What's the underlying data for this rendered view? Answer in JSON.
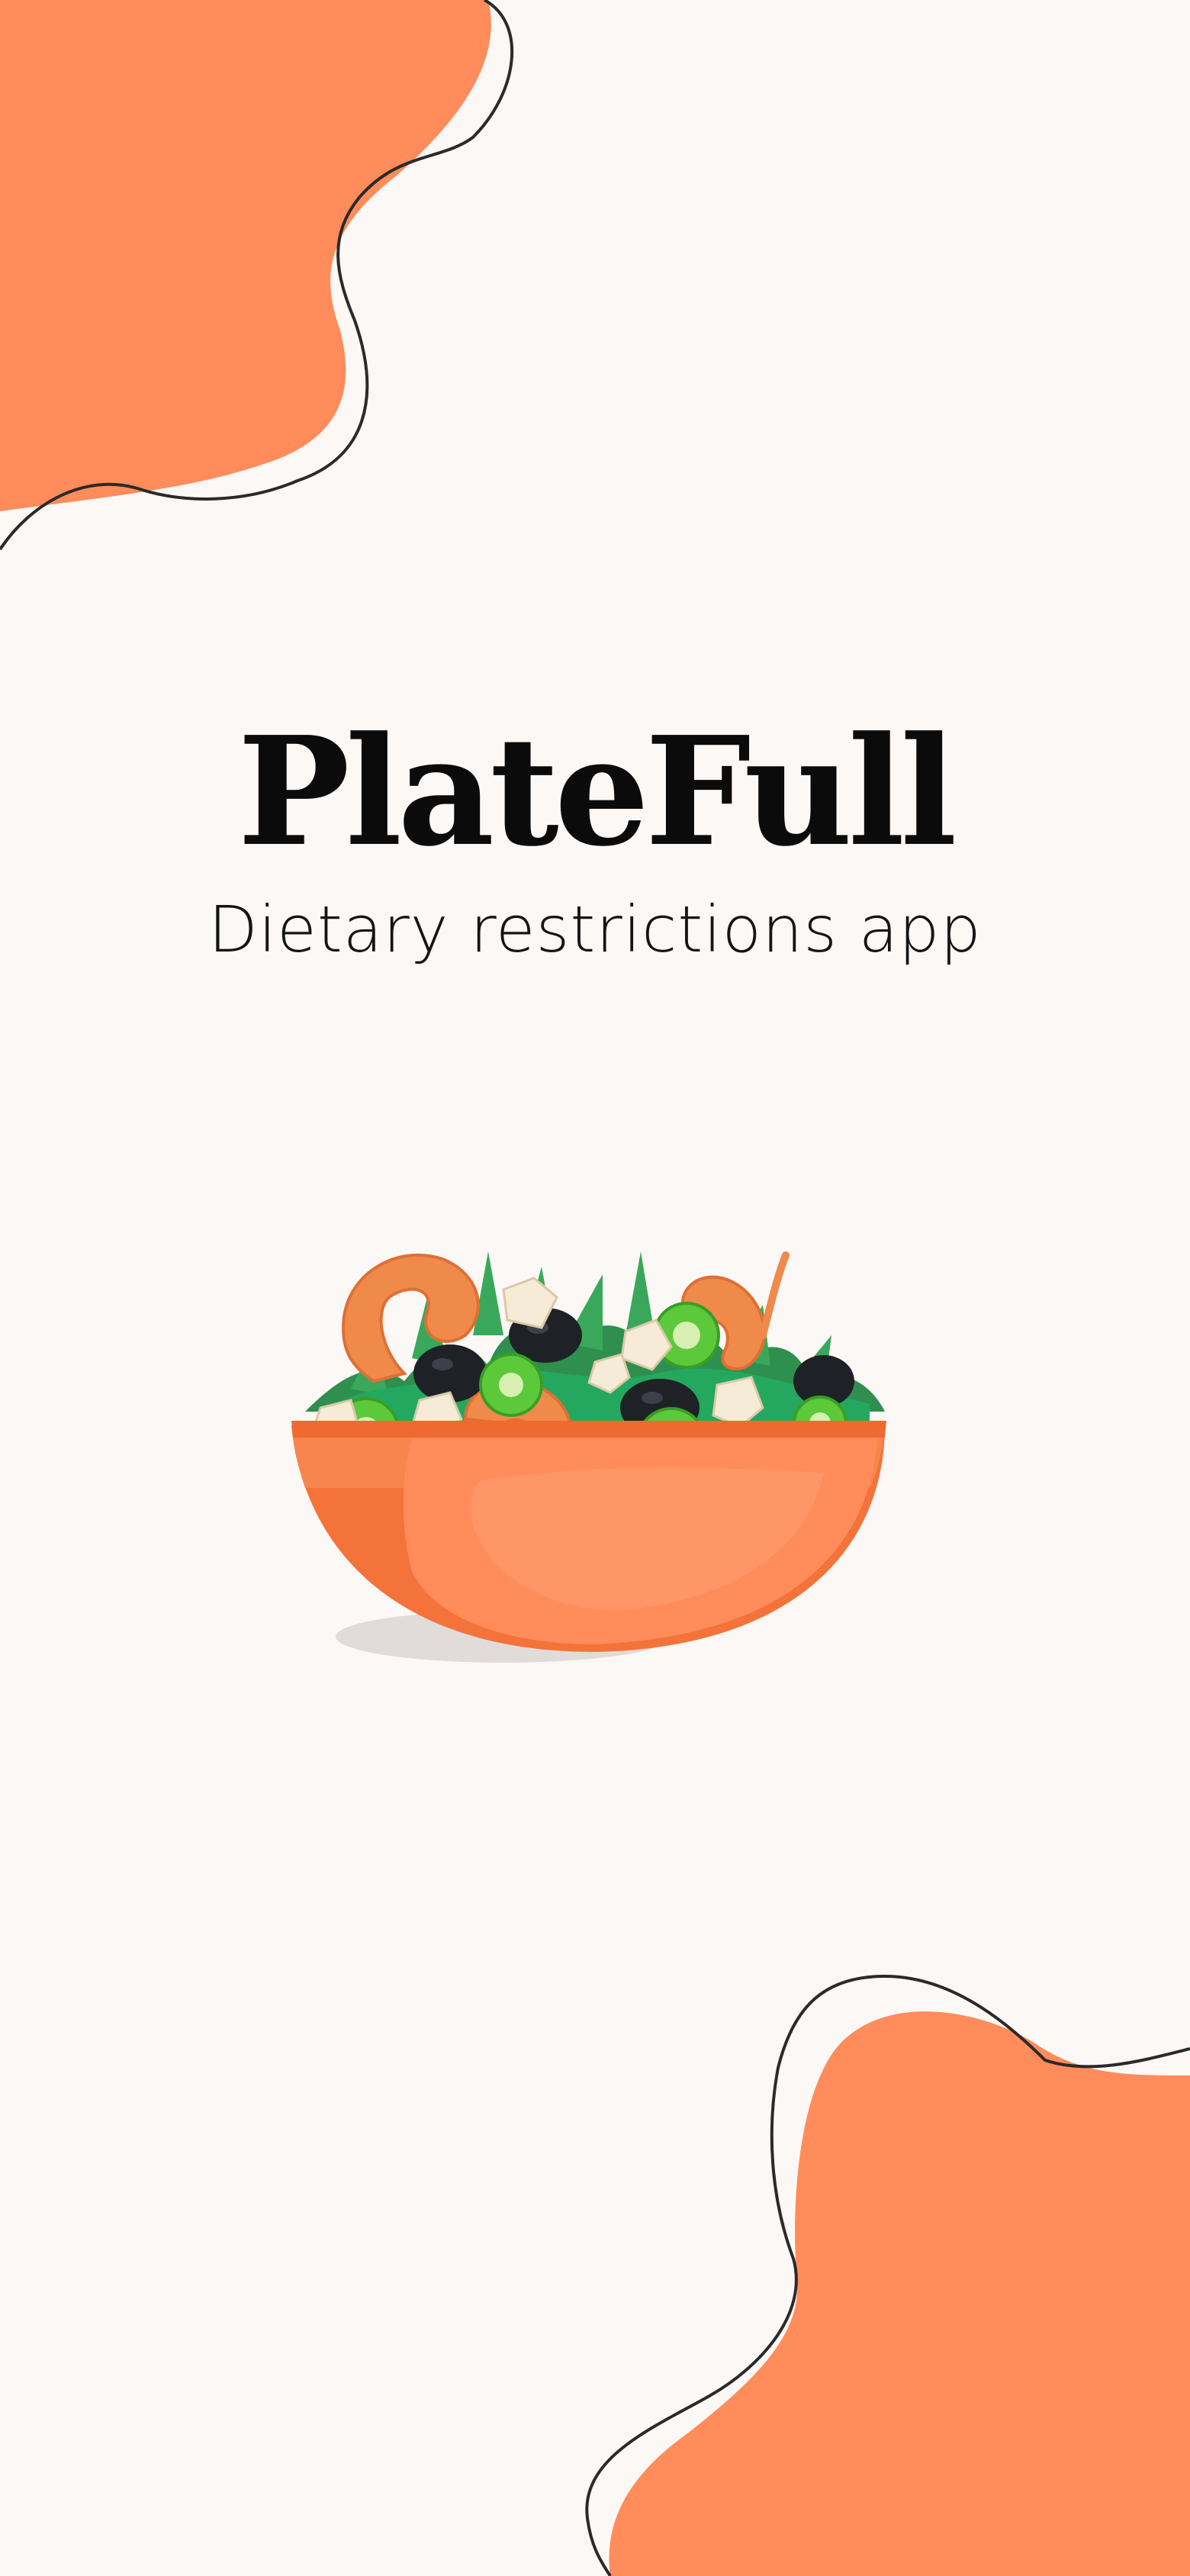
{
  "app": {
    "title": "PlateFull",
    "subtitle": "Dietary restrictions app"
  },
  "colors": {
    "background": "#fcf8f6",
    "accent": "#ff8c5a",
    "text": "#0b0b0b"
  },
  "illustration": {
    "name": "salad-bowl-icon"
  }
}
